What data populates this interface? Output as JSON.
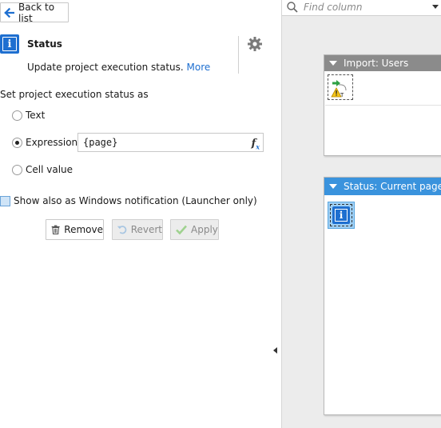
{
  "nav": {
    "back_label": "Back to list"
  },
  "header": {
    "title": "Status",
    "description": "Update project execution status.",
    "more_link": "More",
    "icon": "info-icon",
    "settings_icon": "gear-icon"
  },
  "form": {
    "set_label": "Set project execution status as",
    "options": [
      {
        "label": "Text",
        "selected": false
      },
      {
        "label": "Expression",
        "selected": true
      },
      {
        "label": "Cell value",
        "selected": false
      }
    ],
    "expression_value": "{page}",
    "fx_icon": "fx-icon",
    "notification_label": "Show also as Windows notification (Launcher only)",
    "notification_checked": false
  },
  "buttons": {
    "remove": "Remove",
    "revert": "Revert",
    "apply": "Apply"
  },
  "right": {
    "find_placeholder": "Find column",
    "cards": [
      {
        "title": "Import: Users",
        "color": "#8b8b8b"
      },
      {
        "title": "Status: Current page",
        "color": "#3a93dd"
      }
    ]
  },
  "colors": {
    "accent": "#1e6fd0",
    "selected_card": "#3a93dd"
  }
}
